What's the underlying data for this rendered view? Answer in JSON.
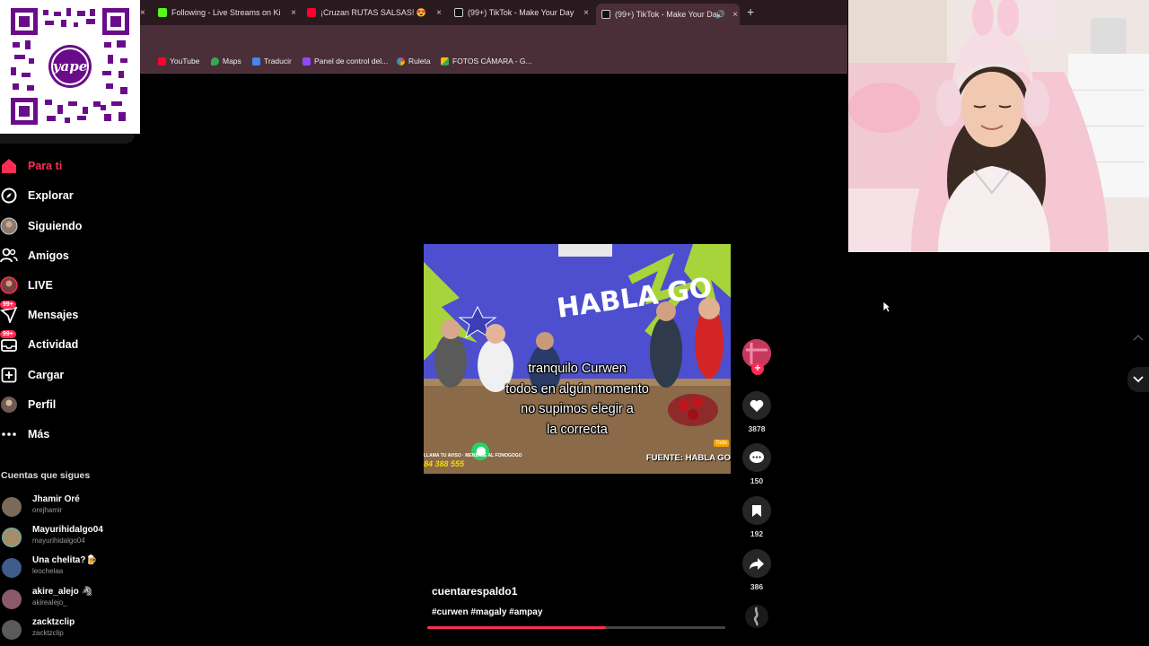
{
  "browser": {
    "tabs": [
      {
        "label": "Following - Live Streams on Ki",
        "icon": "kick-icon",
        "color": "#53fc18"
      },
      {
        "label": "¡Cruzan RUTAS SALSAS! 😍",
        "icon": "youtube-icon",
        "color": "#ff0033"
      },
      {
        "label": "(99+) TikTok - Make Your Day",
        "icon": "tiktok-icon",
        "color": "#ffffff"
      },
      {
        "label": "(99+) TikTok - Make Your Da",
        "icon": "tiktok-icon",
        "color": "#ffffff"
      }
    ],
    "bookmarks": [
      {
        "label": "YouTube",
        "color": "#ff0033"
      },
      {
        "label": "Maps",
        "color": "#34a853"
      },
      {
        "label": "Traducir",
        "color": "#4285f4"
      },
      {
        "label": "Panel de control del...",
        "color": "#9146ff"
      },
      {
        "label": "Ruleta",
        "color": "#ea4335"
      },
      {
        "label": "FOTOS CÁMARA - G...",
        "color": "#fbbc04"
      }
    ]
  },
  "qr_overlay": {
    "brand": "yape"
  },
  "sidebar": {
    "nav": [
      {
        "label": "Para ti",
        "icon": "home-icon",
        "active": true
      },
      {
        "label": "Explorar",
        "icon": "compass-icon"
      },
      {
        "label": "Siguiendo",
        "icon": "following-avatar-icon"
      },
      {
        "label": "Amigos",
        "icon": "friends-icon"
      },
      {
        "label": "LIVE",
        "icon": "live-avatar-icon"
      },
      {
        "label": "Mensajes",
        "icon": "messages-icon",
        "badge": "99+"
      },
      {
        "label": "Actividad",
        "icon": "inbox-icon",
        "badge": "99+"
      },
      {
        "label": "Cargar",
        "icon": "upload-icon"
      },
      {
        "label": "Perfil",
        "icon": "profile-avatar-icon"
      },
      {
        "label": "Más",
        "icon": "more-icon"
      }
    ],
    "following_title": "Cuentas que sigues",
    "accounts": [
      {
        "name": "Jhamir Oré",
        "handle": "orejhamir",
        "color": "#7a6a5a"
      },
      {
        "name": "Mayurihidalgo04",
        "handle": "mayurihidalgo04",
        "color": "#a58d6a"
      },
      {
        "name": "Una chelita?🍺",
        "handle": "leochelaa",
        "color": "#3f5c8a"
      },
      {
        "name": "akire_alejo 🦓",
        "handle": "akirealejo_",
        "color": "#8a5a6a"
      },
      {
        "name": "zacktzclip",
        "handle": "zacktzclip",
        "color": "#5a5a5a"
      }
    ]
  },
  "video": {
    "caption": [
      "tranquilo Curwen",
      "todos en algún momento",
      "no supimos elegir a",
      "la correcta"
    ],
    "studio_sign": "HABLA GO",
    "source": "FUENTE: HABLA GO",
    "promo_line": "LLAMA TU AVISO · MENSAJE AL FONOGOGO",
    "promo_number": "84 388 555",
    "tag": "Todo"
  },
  "actions": {
    "likes": "3878",
    "comments": "150",
    "saves": "192",
    "shares": "386"
  },
  "post": {
    "author": "cuentarespaldo1",
    "hashtags": "#curwen #magaly #ampay",
    "progress": 0.6
  }
}
